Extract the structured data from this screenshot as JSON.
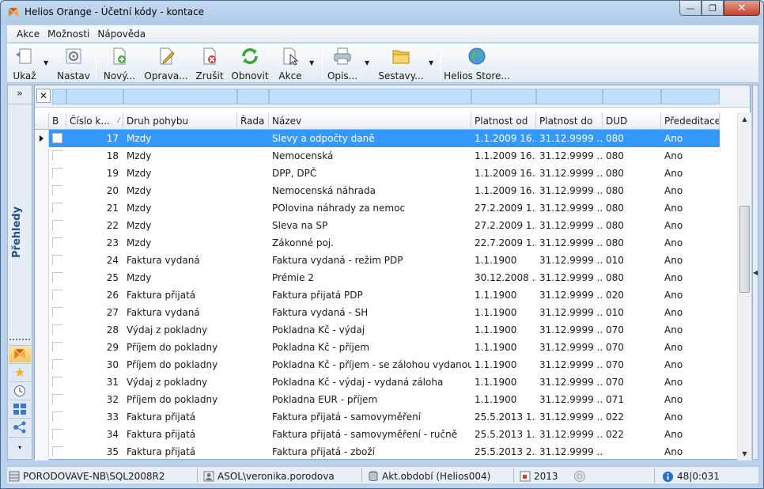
{
  "window": {
    "title": "Helios Orange - Účetní kódy - kontace",
    "minimize": "—",
    "restore": "❐",
    "close": "✕"
  },
  "menu": [
    "Akce",
    "Možnosti",
    "Nápověda"
  ],
  "toolbar": {
    "show": "Ukaž",
    "settings": "Nastav",
    "new": "Nový...",
    "edit": "Oprava...",
    "cancel": "Zrušit",
    "refresh": "Obnovit",
    "actions": "Akce",
    "print": "Opis...",
    "reports": "Sestavy...",
    "store": "Helios Store..."
  },
  "sidebar": {
    "collapse": "»",
    "title": "Přehledy"
  },
  "filter": {
    "clear": "✕"
  },
  "columns": [
    "B",
    "Číslo k...",
    "Druh pohybu",
    "Řada",
    "Název",
    "Platnost od",
    "Platnost do",
    "DUD",
    "Přededitace"
  ],
  "sort_indicator": "⁄",
  "rows": [
    {
      "num": "17",
      "druh": "Mzdy",
      "rada": "",
      "nazev": "Slevy a odpočty daně",
      "od": "1.1.2009 16...",
      "do": "31.12.9999 ...",
      "dud": "080",
      "pred": "Ano"
    },
    {
      "num": "18",
      "druh": "Mzdy",
      "rada": "",
      "nazev": "Nemocenská",
      "od": "1.1.2009 16...",
      "do": "31.12.9999 ...",
      "dud": "080",
      "pred": "Ano"
    },
    {
      "num": "19",
      "druh": "Mzdy",
      "rada": "",
      "nazev": "DPP, DPČ",
      "od": "1.1.2009 16...",
      "do": "31.12.9999 ...",
      "dud": "080",
      "pred": "Ano"
    },
    {
      "num": "20",
      "druh": "Mzdy",
      "rada": "",
      "nazev": "Nemocenská náhrada",
      "od": "1.1.2009 16...",
      "do": "31.12.9999 ...",
      "dud": "080",
      "pred": "Ano"
    },
    {
      "num": "21",
      "druh": "Mzdy",
      "rada": "",
      "nazev": "POlovina náhrady za nemoc",
      "od": "27.2.2009 1...",
      "do": "31.12.9999 ...",
      "dud": "080",
      "pred": "Ano"
    },
    {
      "num": "22",
      "druh": "Mzdy",
      "rada": "",
      "nazev": "Sleva na SP",
      "od": "27.2.2009 1...",
      "do": "31.12.9999 ...",
      "dud": "080",
      "pred": "Ano"
    },
    {
      "num": "23",
      "druh": "Mzdy",
      "rada": "",
      "nazev": "Zákonné poj.",
      "od": "22.7.2009 1...",
      "do": "31.12.9999 ...",
      "dud": "080",
      "pred": "Ano"
    },
    {
      "num": "24",
      "druh": "Faktura vydaná",
      "rada": "",
      "nazev": "Faktura vydaná - režim PDP",
      "od": "1.1.1900",
      "do": "31.12.9999 ...",
      "dud": "010",
      "pred": "Ano"
    },
    {
      "num": "25",
      "druh": "Mzdy",
      "rada": "",
      "nazev": "Prémie 2",
      "od": "30.12.2008 ...",
      "do": "31.12.9999 ...",
      "dud": "080",
      "pred": "Ano"
    },
    {
      "num": "26",
      "druh": "Faktura přijatá",
      "rada": "",
      "nazev": "Faktura přijatá PDP",
      "od": "1.1.1900",
      "do": "31.12.9999 ...",
      "dud": "020",
      "pred": "Ano"
    },
    {
      "num": "27",
      "druh": "Faktura vydaná",
      "rada": "",
      "nazev": "Faktura vydaná - SH",
      "od": "1.1.1900",
      "do": "31.12.9999 ...",
      "dud": "010",
      "pred": "Ano"
    },
    {
      "num": "28",
      "druh": "Výdaj z pokladny",
      "rada": "",
      "nazev": "Pokladna Kč - výdaj",
      "od": "1.1.1900",
      "do": "31.12.9999 ...",
      "dud": "070",
      "pred": "Ano"
    },
    {
      "num": "29",
      "druh": "Příjem do pokladny",
      "rada": "",
      "nazev": "Pokladna Kč - příjem",
      "od": "1.1.1900",
      "do": "31.12.9999 ...",
      "dud": "070",
      "pred": "Ano"
    },
    {
      "num": "30",
      "druh": "Příjem do pokladny",
      "rada": "",
      "nazev": "Pokladna Kč - příjem - se zálohou vydanou",
      "od": "1.1.1900",
      "do": "31.12.9999 ...",
      "dud": "070",
      "pred": "Ano"
    },
    {
      "num": "31",
      "druh": "Výdaj z pokladny",
      "rada": "",
      "nazev": "Pokladna Kč - výdaj - vydaná záloha",
      "od": "1.1.1900",
      "do": "31.12.9999 ...",
      "dud": "070",
      "pred": "Ano"
    },
    {
      "num": "32",
      "druh": "Příjem do pokladny",
      "rada": "",
      "nazev": "Pokladna EUR - příjem",
      "od": "1.1.1900",
      "do": "31.12.9999 ...",
      "dud": "071",
      "pred": "Ano"
    },
    {
      "num": "33",
      "druh": "Faktura přijatá",
      "rada": "",
      "nazev": "Faktura přijatá - samovyměření",
      "od": "25.5.2013 1...",
      "do": "31.12.9999 ...",
      "dud": "022",
      "pred": "Ano"
    },
    {
      "num": "34",
      "druh": "Faktura přijatá",
      "rada": "",
      "nazev": "Faktura přijatá - samovyměření - ručně",
      "od": "25.5.2013 1...",
      "do": "31.12.9999 ...",
      "dud": "022",
      "pred": "Ano"
    },
    {
      "num": "35",
      "druh": "Faktura přijatá",
      "rada": "",
      "nazev": "Faktura přijatá - zboží",
      "od": "25.5.2013 2...",
      "do": "31.12.9999 ...",
      "dud": "",
      "pred": "Ano"
    }
  ],
  "status": {
    "server": "PORODOVAVE-NB\\SQL2008R2",
    "user": "ASOL\\veronika.porodova",
    "period": "Akt.období (Helios004)",
    "year": "2013",
    "info": "48|0:031"
  },
  "colors": {
    "selection": "#3399ff",
    "filter_cell": "#bfe0fb",
    "sidebar_title": "#1f4e8c"
  }
}
